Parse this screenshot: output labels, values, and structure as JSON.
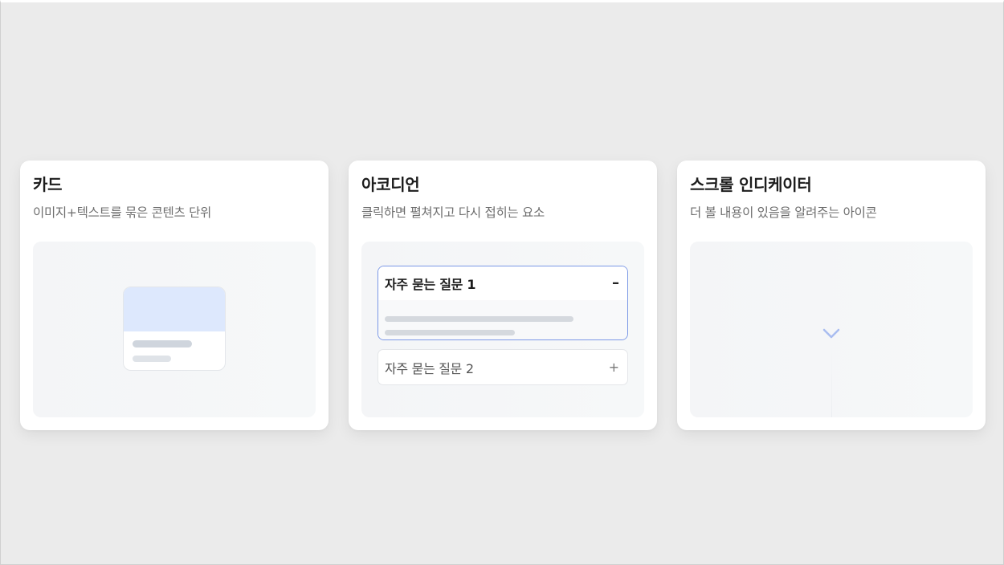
{
  "cards": [
    {
      "title": "카드",
      "description": "이미지+텍스트를 묶은 콘텐츠 단위"
    },
    {
      "title": "아코디언",
      "description": "클릭하면 펼쳐지고 다시 접히는 요소",
      "accordion": {
        "items": [
          {
            "question": "자주 묻는 질문 1",
            "toggle": "–",
            "state": "expanded"
          },
          {
            "question": "자주 묻는 질문 2",
            "toggle": "+",
            "state": "collapsed"
          }
        ]
      }
    },
    {
      "title": "스크롤 인디케이터",
      "description": "더 볼 내용이 있음을 알려주는 아이콘",
      "icon": "chevron-down-icon"
    }
  ],
  "colors": {
    "background": "#ebebeb",
    "card": "#ffffff",
    "accent": "#7b98e6",
    "image_placeholder": "#dde8fd"
  }
}
